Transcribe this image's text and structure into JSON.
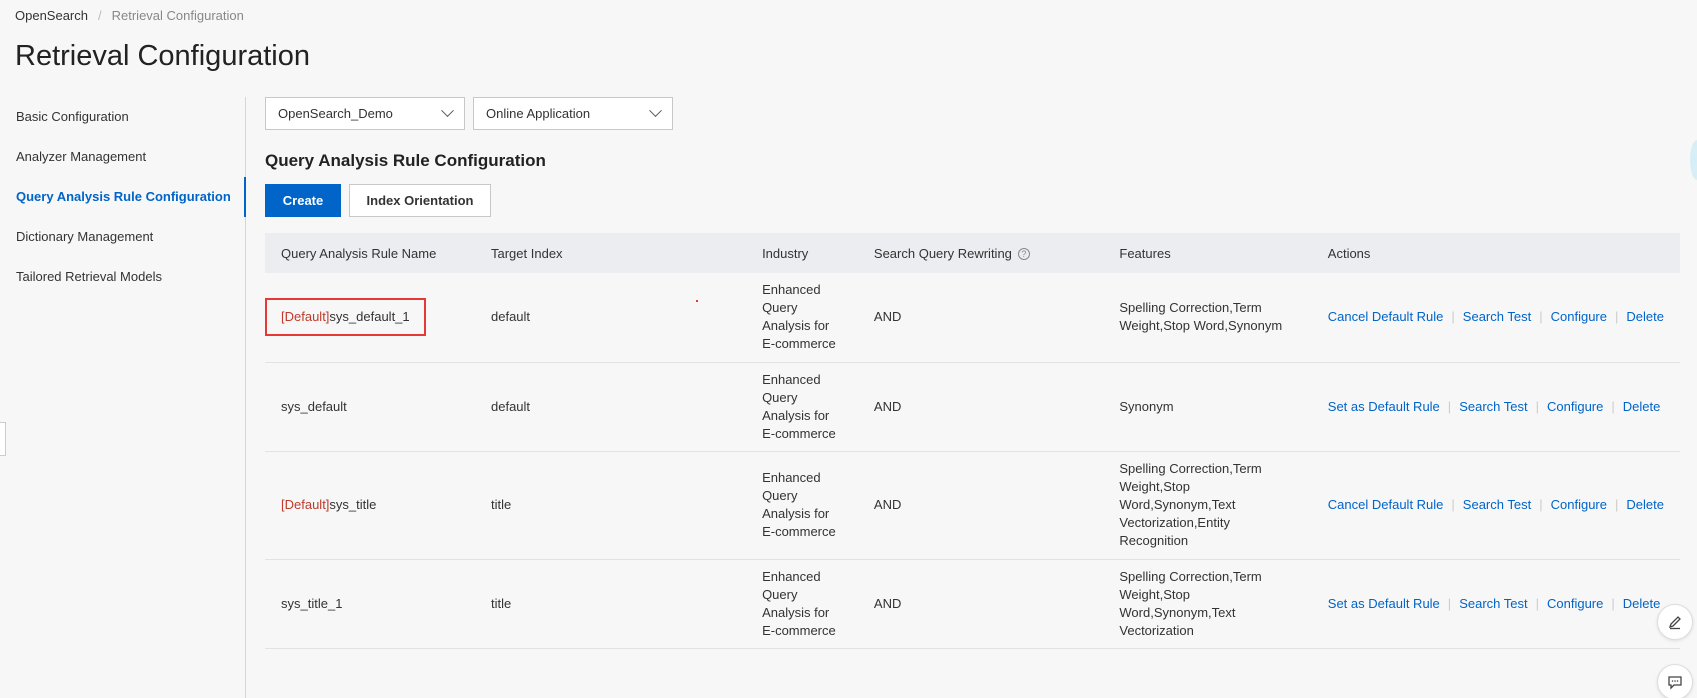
{
  "breadcrumb": {
    "root": "OpenSearch",
    "separator": "/",
    "current": "Retrieval Configuration"
  },
  "page_title": "Retrieval Configuration",
  "sidebar": {
    "items": [
      {
        "label": "Basic Configuration"
      },
      {
        "label": "Analyzer Management"
      },
      {
        "label": "Query Analysis Rule Configuration",
        "active": true
      },
      {
        "label": "Dictionary Management"
      },
      {
        "label": "Tailored Retrieval Models"
      }
    ]
  },
  "selects": {
    "app": "OpenSearch_Demo",
    "mode": "Online Application"
  },
  "section_title": "Query Analysis Rule Configuration",
  "buttons": {
    "create": "Create",
    "index_orientation": "Index Orientation"
  },
  "table": {
    "headers": {
      "name": "Query Analysis Rule Name",
      "index": "Target Index",
      "industry": "Industry",
      "rewriting": "Search Query Rewriting",
      "features": "Features",
      "actions": "Actions"
    },
    "rows": [
      {
        "tag": "[Default]",
        "name": "sys_default_1",
        "index": "default",
        "industry": "Enhanced Query Analysis for E-commerce",
        "rewriting": "AND",
        "features": "Spelling Correction,Term Weight,Stop Word,Synonym",
        "actions": [
          "Cancel Default Rule",
          "Search Test",
          "Configure",
          "Delete"
        ]
      },
      {
        "tag": "",
        "name": "sys_default",
        "index": "default",
        "industry": "Enhanced Query Analysis for E-commerce",
        "rewriting": "AND",
        "features": "Synonym",
        "actions": [
          "Set as Default Rule",
          "Search Test",
          "Configure",
          "Delete"
        ]
      },
      {
        "tag": "[Default]",
        "name": "sys_title",
        "index": "title",
        "industry": "Enhanced Query Analysis for E-commerce",
        "rewriting": "AND",
        "features": "Spelling Correction,Term Weight,Stop Word,Synonym,Text Vectorization,Entity Recognition",
        "actions": [
          "Cancel Default Rule",
          "Search Test",
          "Configure",
          "Delete"
        ]
      },
      {
        "tag": "",
        "name": "sys_title_1",
        "index": "title",
        "industry": "Enhanced Query Analysis for E-commerce",
        "rewriting": "AND",
        "features": "Spelling Correction,Term Weight,Stop Word,Synonym,Text Vectorization",
        "actions": [
          "Set as Default Rule",
          "Search Test",
          "Configure",
          "Delete"
        ]
      }
    ]
  },
  "help_icon": "?",
  "icons": {
    "edit": "pencil-icon",
    "chat": "chat-icon"
  },
  "colors": {
    "accent": "#0064c8",
    "default_tag": "#c0392b",
    "highlight": "#e53935"
  }
}
